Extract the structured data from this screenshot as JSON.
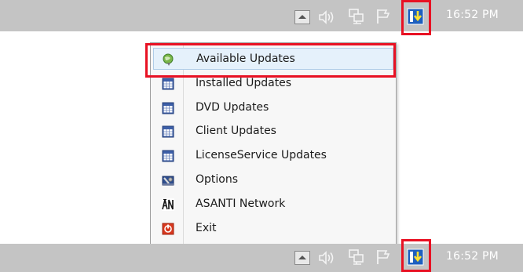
{
  "tray": {
    "clock": "16:52 PM",
    "icons": [
      "chevron-up-icon",
      "speaker-icon",
      "network-icon",
      "flag-icon",
      "update-agent-icon"
    ]
  },
  "menu": {
    "items": [
      {
        "label": "Available Updates",
        "icon": "globe-update-icon"
      },
      {
        "label": "Installed Updates",
        "icon": "calendar-grid-icon"
      },
      {
        "label": "DVD Updates",
        "icon": "calendar-grid-icon"
      },
      {
        "label": "Client Updates",
        "icon": "calendar-grid-icon"
      },
      {
        "label": "LicenseService Updates",
        "icon": "calendar-grid-icon"
      },
      {
        "label": "Options",
        "icon": "options-icon"
      },
      {
        "label": "ASANTI Network",
        "icon": "asanti-logo-icon"
      },
      {
        "label": "Exit",
        "icon": "exit-icon"
      }
    ],
    "highlighted_item": "Available Updates"
  },
  "colors": {
    "taskbar": "#c4c4c4",
    "highlight_box": "#e81123",
    "menu_highlight": "#e5f1fb"
  }
}
